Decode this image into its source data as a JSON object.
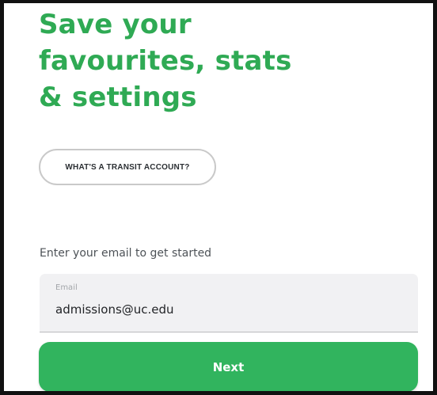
{
  "header": {
    "title_lines": [
      "Save your",
      "favourites, stats",
      "& settings"
    ]
  },
  "info_link": {
    "label": "WHAT'S A TRANSIT ACCOUNT?"
  },
  "signup": {
    "prompt": "Enter your email to get started",
    "email_label": "Email",
    "email_value": "admissions@uc.edu"
  },
  "actions": {
    "next_label": "Next"
  },
  "colors": {
    "brand_green": "#2faa54",
    "button_green": "#31b45e",
    "field_background": "#f1f1f3"
  }
}
